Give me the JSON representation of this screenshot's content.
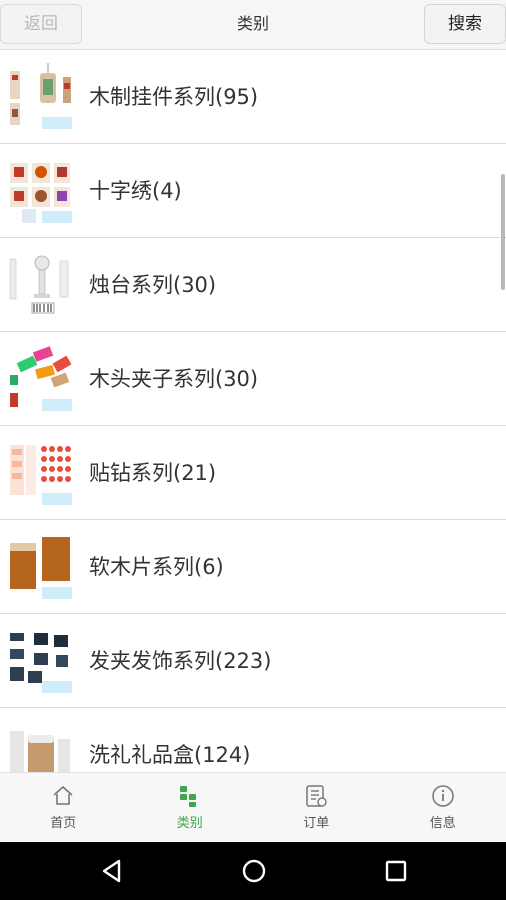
{
  "header": {
    "back_label": "返回",
    "title": "类别",
    "search_label": "搜索"
  },
  "categories": [
    {
      "label": "木制挂件系列(95)",
      "thumb": "wood-pendants"
    },
    {
      "label": "十字绣(4)",
      "thumb": "cross-stitch"
    },
    {
      "label": "烛台系列(30)",
      "thumb": "candle-holders"
    },
    {
      "label": "木头夹子系列(30)",
      "thumb": "wooden-clips"
    },
    {
      "label": "贴钻系列(21)",
      "thumb": "rhinestone-stickers"
    },
    {
      "label": "软木片系列(6)",
      "thumb": "cork-sheets"
    },
    {
      "label": "发夹发饰系列(223)",
      "thumb": "hair-clips"
    },
    {
      "label": "洗礼礼品盒(124)",
      "thumb": "baptism-gift-boxes"
    }
  ],
  "tabs": [
    {
      "label": "首页",
      "icon": "home-icon",
      "active": false
    },
    {
      "label": "类别",
      "icon": "category-icon",
      "active": true
    },
    {
      "label": "订单",
      "icon": "order-icon",
      "active": false
    },
    {
      "label": "信息",
      "icon": "info-icon",
      "active": false
    }
  ],
  "colors": {
    "active_tab": "#3da74a",
    "inactive_tab": "#555555",
    "header_bg": "#f6f6f6",
    "divider": "#dcdcdc"
  },
  "system_nav": [
    "back-icon",
    "home-circle-icon",
    "recents-icon"
  ]
}
